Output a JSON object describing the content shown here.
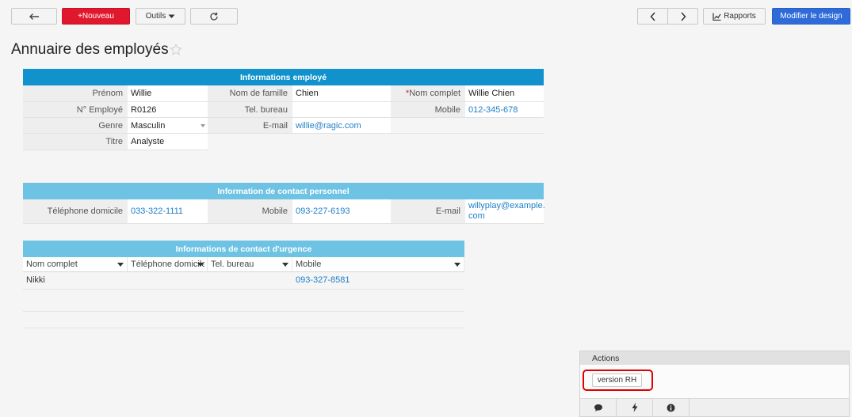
{
  "toolbar": {
    "new_label": "+Nouveau",
    "tools_label": "Outils",
    "reports_label": "Rapports",
    "edit_design_label": "Modifier le design"
  },
  "page": {
    "title": "Annuaire des employés"
  },
  "employee_info": {
    "header": "Informations employé",
    "first_name_label": "Prénom",
    "first_name": "Willie",
    "last_name_label": "Nom de famille",
    "last_name": "Chien",
    "full_name_label": "Nom complet",
    "full_name": "Willie Chien",
    "emp_no_label": "N° Employé",
    "emp_no": "R0126",
    "office_tel_label": "Tel. bureau",
    "office_tel": "",
    "mobile_label": "Mobile",
    "mobile": "012-345-678",
    "gender_label": "Genre",
    "gender": "Masculin",
    "email_label": "E-mail",
    "email": "willie@ragic.com",
    "title_label": "Titre",
    "title": "Analyste"
  },
  "personal_contact": {
    "header": "Information de contact personnel",
    "home_phone_label": "Téléphone domicile",
    "home_phone": "033-322-1111",
    "mobile_label": "Mobile",
    "mobile": "093-227-6193",
    "email_label": "E-mail",
    "email_line1": "willyplay@example.",
    "email_line2": "com"
  },
  "emergency_contact": {
    "header": "Informations de contact d'urgence",
    "columns": [
      "Nom complet",
      "Téléphone domicile",
      "Tel. bureau",
      "Mobile"
    ],
    "rows": [
      {
        "full_name": "Nikki",
        "home_phone": "",
        "office_tel": "",
        "mobile": "093-327-8581"
      }
    ]
  },
  "actions": {
    "header": "Actions",
    "hr_version_label": "version RH"
  },
  "colors": {
    "header_dark": "#1192cc",
    "header_light": "#6ec3e4",
    "link": "#1e7fc7",
    "new_button": "#e0182d",
    "design_button": "#2f6bd8",
    "highlight": "#e00000"
  }
}
